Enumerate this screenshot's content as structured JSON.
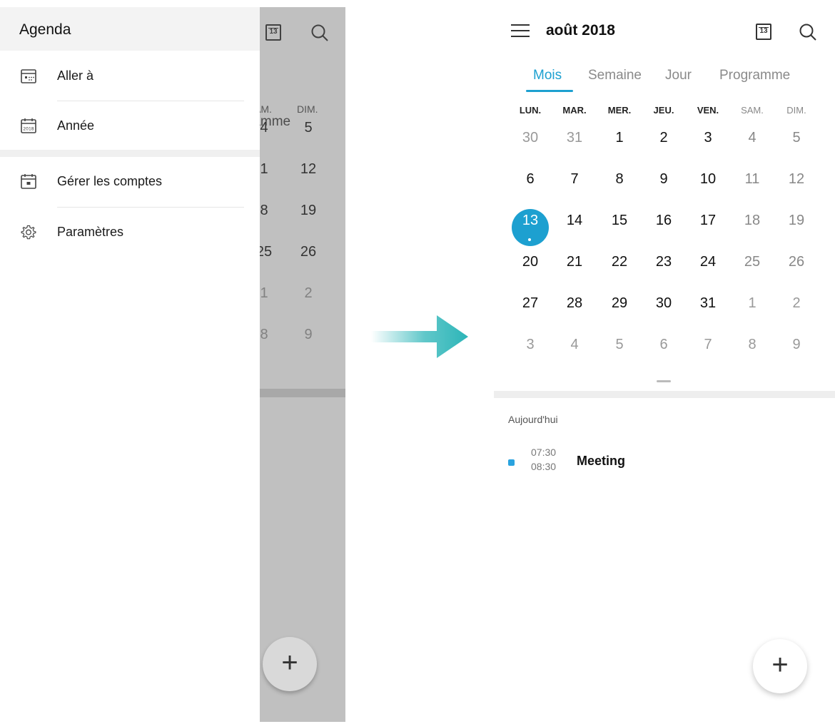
{
  "left": {
    "drawer": {
      "title": "Agenda",
      "items": [
        {
          "label": "Aller à",
          "icon": "goto-calendar-icon"
        },
        {
          "label": "Année",
          "icon": "year-calendar-icon",
          "icon_text": "2018"
        },
        {
          "label": "Gérer les comptes",
          "icon": "manage-calendars-icon"
        },
        {
          "label": "Paramètres",
          "icon": "gear-icon"
        }
      ]
    },
    "background": {
      "calendar_icon_day": "13",
      "tab_text": "ramme",
      "weekday_sam": "AM.",
      "weekday_dim": "DIM.",
      "rows": [
        [
          "4",
          "5"
        ],
        [
          "1",
          "12"
        ],
        [
          "8",
          "19"
        ],
        [
          "25",
          "26"
        ],
        [
          "1",
          "2"
        ],
        [
          "8",
          "9"
        ]
      ],
      "fab_label": "+"
    }
  },
  "right": {
    "header": {
      "month_title": "août 2018",
      "calendar_icon_day": "13"
    },
    "tabs": [
      {
        "label": "Mois",
        "active": true
      },
      {
        "label": "Semaine",
        "active": false
      },
      {
        "label": "Jour",
        "active": false
      },
      {
        "label": "Programme",
        "active": false
      }
    ],
    "weekdays": [
      "LUN.",
      "MAR.",
      "MER.",
      "JEU.",
      "VEN.",
      "SAM.",
      "DIM."
    ],
    "weeks": [
      [
        "30",
        "31",
        "1",
        "2",
        "3",
        "4",
        "5"
      ],
      [
        "6",
        "7",
        "8",
        "9",
        "10",
        "11",
        "12"
      ],
      [
        "13",
        "14",
        "15",
        "16",
        "17",
        "18",
        "19"
      ],
      [
        "20",
        "21",
        "22",
        "23",
        "24",
        "25",
        "26"
      ],
      [
        "27",
        "28",
        "29",
        "30",
        "31",
        "1",
        "2"
      ],
      [
        "3",
        "4",
        "5",
        "6",
        "7",
        "8",
        "9"
      ]
    ],
    "today_section": {
      "label": "Aujourd'hui",
      "event": {
        "start": "07:30",
        "end": "08:30",
        "title": "Meeting"
      }
    },
    "fab_label": "+"
  },
  "colors": {
    "accent": "#1da0d0",
    "event_dot": "#2aa3df",
    "arrow": "#2cb5b8"
  }
}
